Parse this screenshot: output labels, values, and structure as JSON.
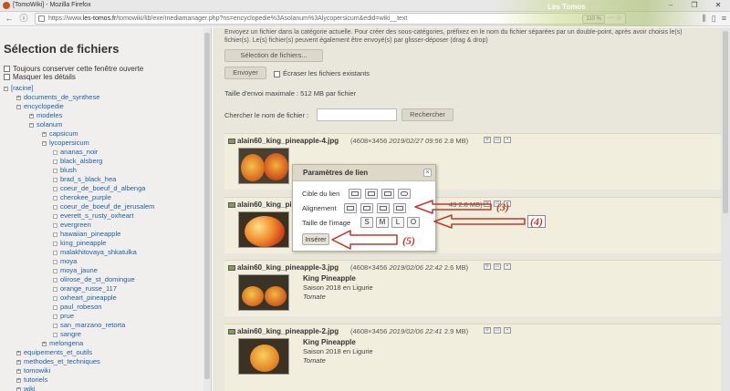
{
  "browser": {
    "window_title": "[TomoWiki] - Mozilla Firefox",
    "url_prefix": "https://www.",
    "url_domain": "les-tomos.fr",
    "url_rest": "/tomowiki/lib/exe/mediamanager.php?ns=encyclopedie%3Asolanum%3Alycopersicum&edid=wiki__text",
    "zoom": "110 %",
    "brand": "Les Tomos"
  },
  "left": {
    "title": "Sélection de fichiers",
    "options": [
      "Toujours conserver cette fenêtre ouverte",
      "Masquer les détails"
    ],
    "tree": [
      {
        "label": "[racine]",
        "level": 0,
        "type": "open"
      },
      {
        "label": "documents_de_synthese",
        "level": 1,
        "type": "closed"
      },
      {
        "label": "encyclopedie",
        "level": 1,
        "type": "open"
      },
      {
        "label": "modeles",
        "level": 2,
        "type": "closed"
      },
      {
        "label": "solanum",
        "level": 2,
        "type": "open"
      },
      {
        "label": "capsicum",
        "level": 3,
        "type": "closed"
      },
      {
        "label": "lycopersicum",
        "level": 3,
        "type": "open"
      },
      {
        "label": "ananas_noir",
        "level": 4,
        "type": "leaf"
      },
      {
        "label": "black_alsberg",
        "level": 4,
        "type": "leaf"
      },
      {
        "label": "blush",
        "level": 4,
        "type": "leaf"
      },
      {
        "label": "brad_s_black_hea",
        "level": 4,
        "type": "leaf"
      },
      {
        "label": "coeur_de_boeuf_d_albenga",
        "level": 4,
        "type": "leaf"
      },
      {
        "label": "cherokee_purple",
        "level": 4,
        "type": "leaf"
      },
      {
        "label": "coeur_de_boeuf_de_jerusalem",
        "level": 4,
        "type": "leaf"
      },
      {
        "label": "everett_s_rusty_oxheart",
        "level": 4,
        "type": "leaf"
      },
      {
        "label": "evergreen",
        "level": 4,
        "type": "leaf"
      },
      {
        "label": "hawaiian_pineapple",
        "level": 4,
        "type": "leaf"
      },
      {
        "label": "king_pineapple",
        "level": 4,
        "type": "leaf"
      },
      {
        "label": "malakhitovaya_shkatulka",
        "level": 4,
        "type": "leaf"
      },
      {
        "label": "moya",
        "level": 4,
        "type": "leaf"
      },
      {
        "label": "moya_jaune",
        "level": 4,
        "type": "leaf"
      },
      {
        "label": "olirose_de_st_domingue",
        "level": 4,
        "type": "leaf"
      },
      {
        "label": "orange_russe_117",
        "level": 4,
        "type": "leaf"
      },
      {
        "label": "oxheart_pineapple",
        "level": 4,
        "type": "leaf"
      },
      {
        "label": "paul_robeson",
        "level": 4,
        "type": "leaf"
      },
      {
        "label": "prue",
        "level": 4,
        "type": "leaf"
      },
      {
        "label": "san_marzano_retorta",
        "level": 4,
        "type": "leaf"
      },
      {
        "label": "sangre",
        "level": 4,
        "type": "leaf"
      },
      {
        "label": "melongena",
        "level": 3,
        "type": "closed"
      },
      {
        "label": "equipements_et_outils",
        "level": 1,
        "type": "closed"
      },
      {
        "label": "methodes_et_techniques",
        "level": 1,
        "type": "closed"
      },
      {
        "label": "tomowiki",
        "level": 1,
        "type": "closed"
      },
      {
        "label": "tutoriels",
        "level": 1,
        "type": "closed"
      },
      {
        "label": "wiki",
        "level": 1,
        "type": "closed"
      }
    ]
  },
  "main": {
    "intro": "Envoyez un fichier dans la catégorie actuelle. Pour créer des sous-catégories, préfixez en le nom du fichier séparées par un double-point, après avoir choisis le(s) fichier(s). Le(s) fichier(s) peuvent également être envoyé(s) par glisser-déposer (drag & drop)",
    "select_files": "Sélection de fichiers...",
    "send": "Envoyer",
    "overwrite": "Écraser les fichiers existants",
    "max_size": "Taille d'envoi maximale : 512 MB par fichier",
    "search_label": "Chercher le nom de fichier :",
    "search_value": "",
    "search_button": "Rechercher",
    "files": [
      {
        "name": "alain60_king_pineapple-4.jpg",
        "dims": "(4608×3456",
        "date": "2019/02/27 09:56",
        "size": "2.8 MB)",
        "title": "",
        "desc": "",
        "tag": ""
      },
      {
        "name": "alain60_king_pi",
        "dims": "",
        "date": "",
        "size": "43 2.8 MB)",
        "title": "",
        "desc": "",
        "tag": ""
      },
      {
        "name": "alain60_king_pineapple-3.jpg",
        "dims": "(4608×3456",
        "date": "2019/02/06 22:42",
        "size": "2.6 MB)",
        "title": "King Pineapple",
        "desc": "Saison 2018 en Ligurie",
        "tag": "Tomate"
      },
      {
        "name": "alain60_king_pineapple-2.jpg",
        "dims": "(4608×3456",
        "date": "2019/02/06 22:41",
        "size": "2.9 MB)",
        "title": "King Pineapple",
        "desc": "Saison 2018 en Ligurie",
        "tag": "Tomate"
      }
    ]
  },
  "dialog": {
    "title": "Paramètres de lien",
    "close": "×",
    "target_label": "Cible du lien",
    "align_label": "Alignement",
    "size_label": "Taille de l'image",
    "sizes": [
      "S",
      "M",
      "L",
      "O"
    ],
    "insert": "Insérer"
  },
  "annotations": {
    "a3": "(3)",
    "a4": "(4)",
    "a5": "(5)",
    "color": "#c0392b"
  }
}
